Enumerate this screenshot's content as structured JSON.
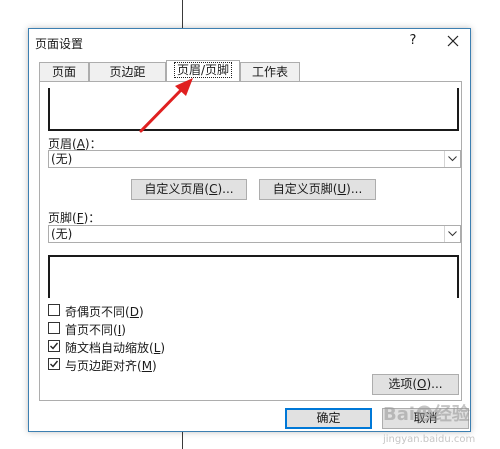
{
  "dialog": {
    "title": "页面设置",
    "help_label": "?",
    "tabs": [
      {
        "label": "页面"
      },
      {
        "label": "页边距"
      },
      {
        "label": "页眉/页脚"
      },
      {
        "label": "工作表"
      }
    ],
    "header": {
      "label_prefix": "页眉(",
      "label_key": "A",
      "label_suffix": ")：",
      "selected_value": "(无)"
    },
    "custom_header_button": {
      "prefix": "自定义页眉(",
      "key": "C",
      "suffix": ")..."
    },
    "custom_footer_button": {
      "prefix": "自定义页脚(",
      "key": "U",
      "suffix": ")..."
    },
    "footer": {
      "label_prefix": "页脚(",
      "label_key": "F",
      "label_suffix": ")：",
      "selected_value": "(无)"
    },
    "checkboxes": [
      {
        "prefix": "奇偶页不同(",
        "key": "D",
        "suffix": ")",
        "checked": false
      },
      {
        "prefix": "首页不同(",
        "key": "I",
        "suffix": ")",
        "checked": false
      },
      {
        "prefix": "随文档自动缩放(",
        "key": "L",
        "suffix": ")",
        "checked": true
      },
      {
        "prefix": "与页边距对齐(",
        "key": "M",
        "suffix": ")",
        "checked": true
      }
    ],
    "options_button": {
      "prefix": "选项(",
      "key": "O",
      "suffix": ")..."
    },
    "ok_label": "确定",
    "cancel_label": "取消"
  },
  "annotation": {
    "arrow_color": "#e02020"
  },
  "watermark": {
    "text": "Bai",
    "text2": "经验",
    "sub": "jingyan.baidu.com"
  }
}
